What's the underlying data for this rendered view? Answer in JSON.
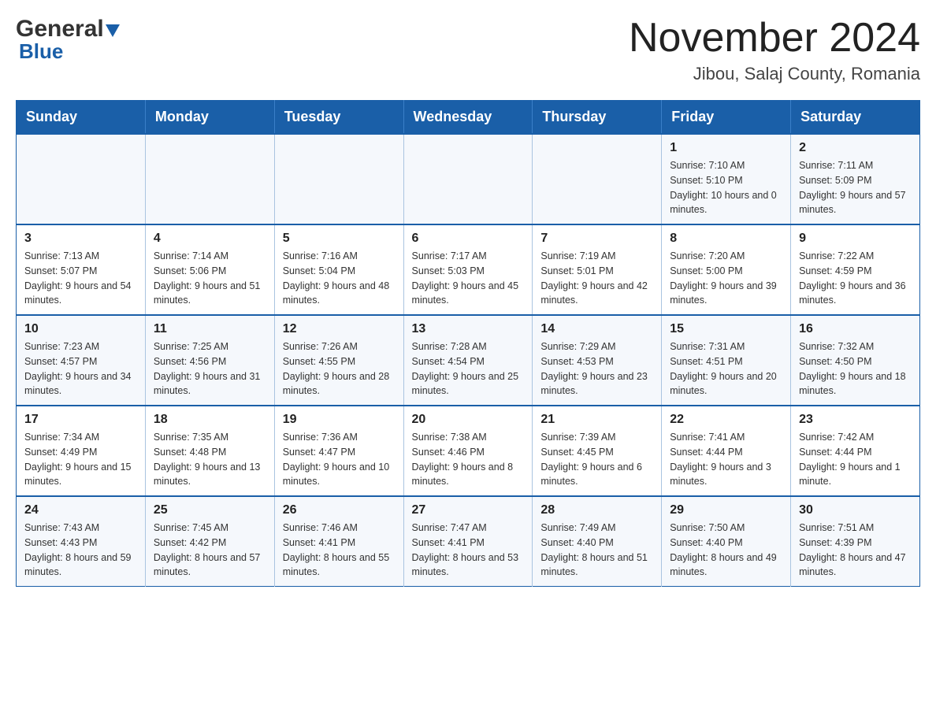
{
  "header": {
    "logo_line1": "General",
    "logo_line2": "Blue",
    "month_title": "November 2024",
    "location": "Jibou, Salaj County, Romania"
  },
  "days_of_week": [
    "Sunday",
    "Monday",
    "Tuesday",
    "Wednesday",
    "Thursday",
    "Friday",
    "Saturday"
  ],
  "weeks": [
    [
      {
        "day": "",
        "sunrise": "",
        "sunset": "",
        "daylight": ""
      },
      {
        "day": "",
        "sunrise": "",
        "sunset": "",
        "daylight": ""
      },
      {
        "day": "",
        "sunrise": "",
        "sunset": "",
        "daylight": ""
      },
      {
        "day": "",
        "sunrise": "",
        "sunset": "",
        "daylight": ""
      },
      {
        "day": "",
        "sunrise": "",
        "sunset": "",
        "daylight": ""
      },
      {
        "day": "1",
        "sunrise": "Sunrise: 7:10 AM",
        "sunset": "Sunset: 5:10 PM",
        "daylight": "Daylight: 10 hours and 0 minutes."
      },
      {
        "day": "2",
        "sunrise": "Sunrise: 7:11 AM",
        "sunset": "Sunset: 5:09 PM",
        "daylight": "Daylight: 9 hours and 57 minutes."
      }
    ],
    [
      {
        "day": "3",
        "sunrise": "Sunrise: 7:13 AM",
        "sunset": "Sunset: 5:07 PM",
        "daylight": "Daylight: 9 hours and 54 minutes."
      },
      {
        "day": "4",
        "sunrise": "Sunrise: 7:14 AM",
        "sunset": "Sunset: 5:06 PM",
        "daylight": "Daylight: 9 hours and 51 minutes."
      },
      {
        "day": "5",
        "sunrise": "Sunrise: 7:16 AM",
        "sunset": "Sunset: 5:04 PM",
        "daylight": "Daylight: 9 hours and 48 minutes."
      },
      {
        "day": "6",
        "sunrise": "Sunrise: 7:17 AM",
        "sunset": "Sunset: 5:03 PM",
        "daylight": "Daylight: 9 hours and 45 minutes."
      },
      {
        "day": "7",
        "sunrise": "Sunrise: 7:19 AM",
        "sunset": "Sunset: 5:01 PM",
        "daylight": "Daylight: 9 hours and 42 minutes."
      },
      {
        "day": "8",
        "sunrise": "Sunrise: 7:20 AM",
        "sunset": "Sunset: 5:00 PM",
        "daylight": "Daylight: 9 hours and 39 minutes."
      },
      {
        "day": "9",
        "sunrise": "Sunrise: 7:22 AM",
        "sunset": "Sunset: 4:59 PM",
        "daylight": "Daylight: 9 hours and 36 minutes."
      }
    ],
    [
      {
        "day": "10",
        "sunrise": "Sunrise: 7:23 AM",
        "sunset": "Sunset: 4:57 PM",
        "daylight": "Daylight: 9 hours and 34 minutes."
      },
      {
        "day": "11",
        "sunrise": "Sunrise: 7:25 AM",
        "sunset": "Sunset: 4:56 PM",
        "daylight": "Daylight: 9 hours and 31 minutes."
      },
      {
        "day": "12",
        "sunrise": "Sunrise: 7:26 AM",
        "sunset": "Sunset: 4:55 PM",
        "daylight": "Daylight: 9 hours and 28 minutes."
      },
      {
        "day": "13",
        "sunrise": "Sunrise: 7:28 AM",
        "sunset": "Sunset: 4:54 PM",
        "daylight": "Daylight: 9 hours and 25 minutes."
      },
      {
        "day": "14",
        "sunrise": "Sunrise: 7:29 AM",
        "sunset": "Sunset: 4:53 PM",
        "daylight": "Daylight: 9 hours and 23 minutes."
      },
      {
        "day": "15",
        "sunrise": "Sunrise: 7:31 AM",
        "sunset": "Sunset: 4:51 PM",
        "daylight": "Daylight: 9 hours and 20 minutes."
      },
      {
        "day": "16",
        "sunrise": "Sunrise: 7:32 AM",
        "sunset": "Sunset: 4:50 PM",
        "daylight": "Daylight: 9 hours and 18 minutes."
      }
    ],
    [
      {
        "day": "17",
        "sunrise": "Sunrise: 7:34 AM",
        "sunset": "Sunset: 4:49 PM",
        "daylight": "Daylight: 9 hours and 15 minutes."
      },
      {
        "day": "18",
        "sunrise": "Sunrise: 7:35 AM",
        "sunset": "Sunset: 4:48 PM",
        "daylight": "Daylight: 9 hours and 13 minutes."
      },
      {
        "day": "19",
        "sunrise": "Sunrise: 7:36 AM",
        "sunset": "Sunset: 4:47 PM",
        "daylight": "Daylight: 9 hours and 10 minutes."
      },
      {
        "day": "20",
        "sunrise": "Sunrise: 7:38 AM",
        "sunset": "Sunset: 4:46 PM",
        "daylight": "Daylight: 9 hours and 8 minutes."
      },
      {
        "day": "21",
        "sunrise": "Sunrise: 7:39 AM",
        "sunset": "Sunset: 4:45 PM",
        "daylight": "Daylight: 9 hours and 6 minutes."
      },
      {
        "day": "22",
        "sunrise": "Sunrise: 7:41 AM",
        "sunset": "Sunset: 4:44 PM",
        "daylight": "Daylight: 9 hours and 3 minutes."
      },
      {
        "day": "23",
        "sunrise": "Sunrise: 7:42 AM",
        "sunset": "Sunset: 4:44 PM",
        "daylight": "Daylight: 9 hours and 1 minute."
      }
    ],
    [
      {
        "day": "24",
        "sunrise": "Sunrise: 7:43 AM",
        "sunset": "Sunset: 4:43 PM",
        "daylight": "Daylight: 8 hours and 59 minutes."
      },
      {
        "day": "25",
        "sunrise": "Sunrise: 7:45 AM",
        "sunset": "Sunset: 4:42 PM",
        "daylight": "Daylight: 8 hours and 57 minutes."
      },
      {
        "day": "26",
        "sunrise": "Sunrise: 7:46 AM",
        "sunset": "Sunset: 4:41 PM",
        "daylight": "Daylight: 8 hours and 55 minutes."
      },
      {
        "day": "27",
        "sunrise": "Sunrise: 7:47 AM",
        "sunset": "Sunset: 4:41 PM",
        "daylight": "Daylight: 8 hours and 53 minutes."
      },
      {
        "day": "28",
        "sunrise": "Sunrise: 7:49 AM",
        "sunset": "Sunset: 4:40 PM",
        "daylight": "Daylight: 8 hours and 51 minutes."
      },
      {
        "day": "29",
        "sunrise": "Sunrise: 7:50 AM",
        "sunset": "Sunset: 4:40 PM",
        "daylight": "Daylight: 8 hours and 49 minutes."
      },
      {
        "day": "30",
        "sunrise": "Sunrise: 7:51 AM",
        "sunset": "Sunset: 4:39 PM",
        "daylight": "Daylight: 8 hours and 47 minutes."
      }
    ]
  ]
}
